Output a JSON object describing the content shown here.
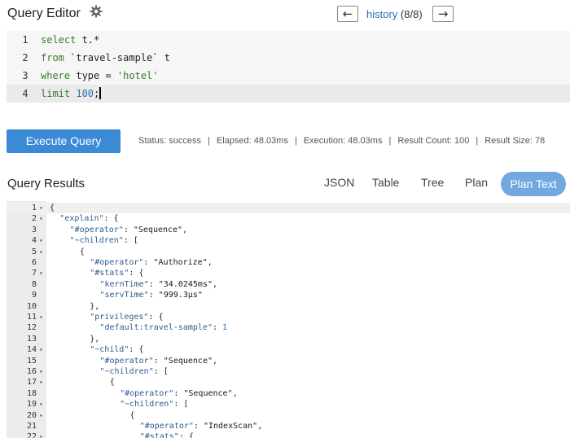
{
  "header": {
    "title": "Query Editor",
    "history_label": "history",
    "history_count": "(8/8)",
    "prev_arrow": "←",
    "next_arrow": "→"
  },
  "editor": {
    "lines": [
      {
        "num": "1",
        "tokens": [
          [
            "kw",
            "select"
          ],
          [
            "plain",
            " t.*"
          ]
        ]
      },
      {
        "num": "2",
        "tokens": [
          [
            "kw",
            "from"
          ],
          [
            "plain",
            " `travel-sample` t"
          ]
        ]
      },
      {
        "num": "3",
        "tokens": [
          [
            "kw",
            "where"
          ],
          [
            "plain",
            " type = "
          ],
          [
            "str",
            "'hotel'"
          ]
        ]
      },
      {
        "num": "4",
        "tokens": [
          [
            "kw",
            "limit"
          ],
          [
            "plain",
            " "
          ],
          [
            "num",
            "100"
          ],
          [
            "plain",
            ";"
          ]
        ]
      }
    ]
  },
  "execute": {
    "button_label": "Execute Query",
    "status": "Status: success",
    "elapsed": "Elapsed: 48.03ms",
    "execution": "Execution: 48.03ms",
    "result_count": "Result Count: 100",
    "result_size": "Result Size: 78"
  },
  "results": {
    "title": "Query Results",
    "tabs": [
      "JSON",
      "Table",
      "Tree",
      "Plan",
      "Plan Text"
    ],
    "active_tab": "Plan Text"
  },
  "json_lines": [
    {
      "num": "1",
      "fold": true,
      "indent": 0,
      "tokens": [
        [
          "p",
          "{"
        ]
      ]
    },
    {
      "num": "2",
      "fold": true,
      "indent": 1,
      "tokens": [
        [
          "k",
          "\"explain\""
        ],
        [
          "p",
          ": {"
        ]
      ]
    },
    {
      "num": "3",
      "fold": false,
      "indent": 2,
      "tokens": [
        [
          "k",
          "\"#operator\""
        ],
        [
          "p",
          ": "
        ],
        [
          "s",
          "\"Sequence\""
        ],
        [
          "p",
          ","
        ]
      ]
    },
    {
      "num": "4",
      "fold": true,
      "indent": 2,
      "tokens": [
        [
          "k",
          "\"~children\""
        ],
        [
          "p",
          ": ["
        ]
      ]
    },
    {
      "num": "5",
      "fold": true,
      "indent": 3,
      "tokens": [
        [
          "p",
          "{"
        ]
      ]
    },
    {
      "num": "6",
      "fold": false,
      "indent": 4,
      "tokens": [
        [
          "k",
          "\"#operator\""
        ],
        [
          "p",
          ": "
        ],
        [
          "s",
          "\"Authorize\""
        ],
        [
          "p",
          ","
        ]
      ]
    },
    {
      "num": "7",
      "fold": true,
      "indent": 4,
      "tokens": [
        [
          "k",
          "\"#stats\""
        ],
        [
          "p",
          ": {"
        ]
      ]
    },
    {
      "num": "8",
      "fold": false,
      "indent": 5,
      "tokens": [
        [
          "k",
          "\"kernTime\""
        ],
        [
          "p",
          ": "
        ],
        [
          "s",
          "\"34.0245ms\""
        ],
        [
          "p",
          ","
        ]
      ]
    },
    {
      "num": "9",
      "fold": false,
      "indent": 5,
      "tokens": [
        [
          "k",
          "\"servTime\""
        ],
        [
          "p",
          ": "
        ],
        [
          "s",
          "\"999.3µs\""
        ]
      ]
    },
    {
      "num": "10",
      "fold": false,
      "indent": 4,
      "tokens": [
        [
          "p",
          "},"
        ]
      ]
    },
    {
      "num": "11",
      "fold": true,
      "indent": 4,
      "tokens": [
        [
          "k",
          "\"privileges\""
        ],
        [
          "p",
          ": {"
        ]
      ]
    },
    {
      "num": "12",
      "fold": false,
      "indent": 5,
      "tokens": [
        [
          "k",
          "\"default:travel-sample\""
        ],
        [
          "p",
          ": "
        ],
        [
          "n",
          "1"
        ]
      ]
    },
    {
      "num": "13",
      "fold": false,
      "indent": 4,
      "tokens": [
        [
          "p",
          "},"
        ]
      ]
    },
    {
      "num": "14",
      "fold": true,
      "indent": 4,
      "tokens": [
        [
          "k",
          "\"~child\""
        ],
        [
          "p",
          ": {"
        ]
      ]
    },
    {
      "num": "15",
      "fold": false,
      "indent": 5,
      "tokens": [
        [
          "k",
          "\"#operator\""
        ],
        [
          "p",
          ": "
        ],
        [
          "s",
          "\"Sequence\""
        ],
        [
          "p",
          ","
        ]
      ]
    },
    {
      "num": "16",
      "fold": true,
      "indent": 5,
      "tokens": [
        [
          "k",
          "\"~children\""
        ],
        [
          "p",
          ": ["
        ]
      ]
    },
    {
      "num": "17",
      "fold": true,
      "indent": 6,
      "tokens": [
        [
          "p",
          "{"
        ]
      ]
    },
    {
      "num": "18",
      "fold": false,
      "indent": 7,
      "tokens": [
        [
          "k",
          "\"#operator\""
        ],
        [
          "p",
          ": "
        ],
        [
          "s",
          "\"Sequence\""
        ],
        [
          "p",
          ","
        ]
      ]
    },
    {
      "num": "19",
      "fold": true,
      "indent": 7,
      "tokens": [
        [
          "k",
          "\"~children\""
        ],
        [
          "p",
          ": ["
        ]
      ]
    },
    {
      "num": "20",
      "fold": true,
      "indent": 8,
      "tokens": [
        [
          "p",
          "{"
        ]
      ]
    },
    {
      "num": "21",
      "fold": false,
      "indent": 9,
      "tokens": [
        [
          "k",
          "\"#operator\""
        ],
        [
          "p",
          ": "
        ],
        [
          "s",
          "\"IndexScan\""
        ],
        [
          "p",
          ","
        ]
      ]
    },
    {
      "num": "22",
      "fold": true,
      "indent": 9,
      "tokens": [
        [
          "k",
          "\"#stats\""
        ],
        [
          "p",
          ": {"
        ]
      ]
    }
  ],
  "icons": {
    "gear": "gear-icon",
    "fold": "fold-arrow-icon"
  },
  "colors": {
    "accent": "#3a8ad6",
    "active_tab": "#72a8e0",
    "keyword": "#3a7a2e"
  }
}
